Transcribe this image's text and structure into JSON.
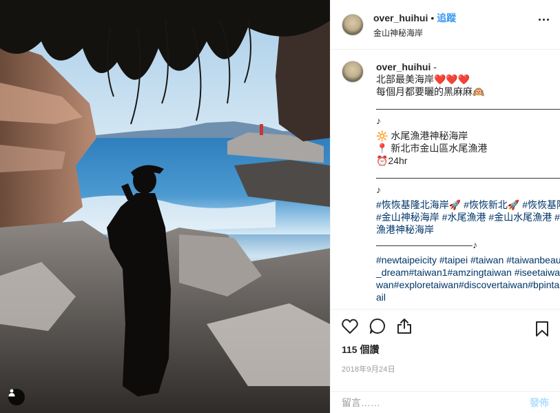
{
  "post": {
    "username": "over_huihui",
    "separator": "•",
    "follow_label": "追蹤",
    "location": "金山神秘海岸"
  },
  "caption": {
    "username": "over_huihui",
    "suffix": " -",
    "lines": [
      "北部最美海岸❤️❤️❤️",
      "每個月都要曬的黑麻麻🙉",
      "————————————————————————♪",
      "🔆 水尾漁港神秘海岸",
      "📍 新北市金山區水尾漁港",
      "⏰24hr",
      "————————————————————————♪"
    ],
    "hashtags_1": "#恢恢基隆北海岸🚀 #恢恢新北🚀 #恢恢基隆🚀 #金山#金山神秘海岸 #水尾漁港 #金山水尾漁港 #金山水尾漁港神秘海岸",
    "divider_3": "——————————♪",
    "hashtags_2": "#newtaipeicity #taipei #taiwan #taiwanbeauty #taiwan_dream#taiwan1#amzingtaiwan #iseetaiwan#igerstaiwan#exploretaiwan#discovertaiwan#bpintaiwan#popdail"
  },
  "actions": {
    "like_icon": "heart-outline-icon",
    "comment_icon": "speech-bubble-icon",
    "share_icon": "share-upload-icon",
    "save_icon": "bookmark-outline-icon",
    "likes_text": "115 個讚",
    "date_text": "2018年9月24日"
  },
  "comment": {
    "placeholder": "留言……",
    "post_label": "發佈"
  },
  "colors": {
    "link": "#003569",
    "follow": "#3897f0",
    "post_disabled": "#b2dffc",
    "muted": "#999999"
  }
}
